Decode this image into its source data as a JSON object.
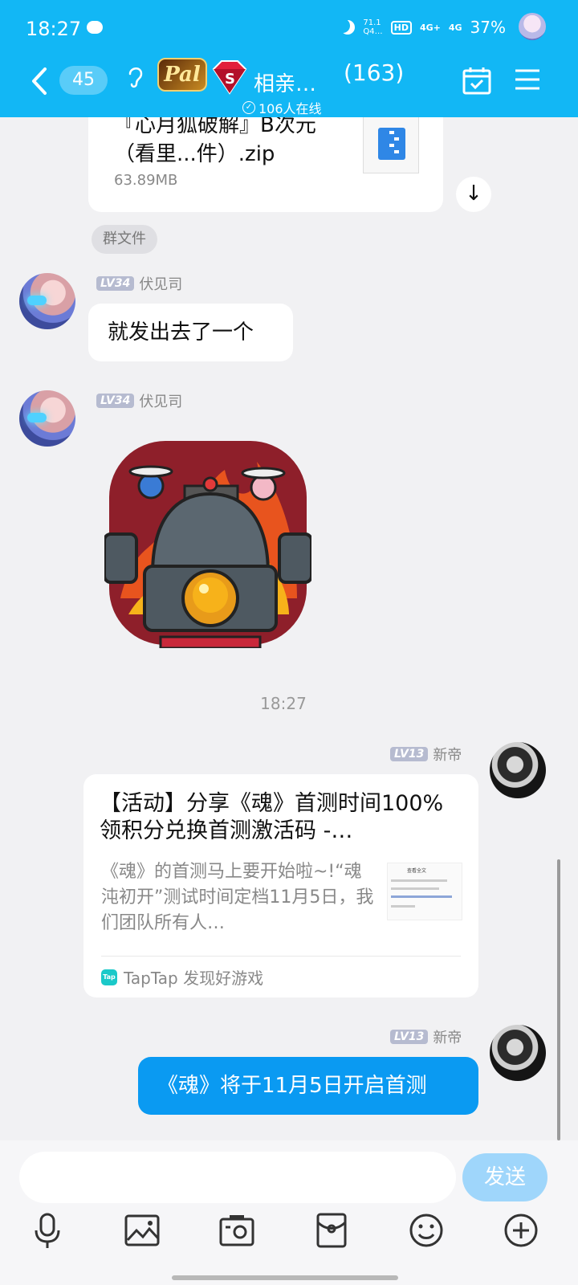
{
  "status_bar": {
    "time": "18:27",
    "net_speed_top": "71.1",
    "net_speed_bottom": "Q4…",
    "hd_badge": "HD",
    "signal_1": "4G+",
    "signal_2": "4G",
    "battery": "37%"
  },
  "header": {
    "unread_count": "45",
    "logo_text": "Pal",
    "group_name": "相亲…",
    "member_count": "(163)",
    "online_text": "106人在线"
  },
  "file_message": {
    "file_name": "『心月狐破解』B次元（看里...件）.zip",
    "file_size": "63.89MB",
    "tag": "群文件"
  },
  "messages": [
    {
      "level": "LV34",
      "sender": "伏见司",
      "text": "就发出去了一个"
    },
    {
      "level": "LV34",
      "sender": "伏见司",
      "sticker": "robot-sticker"
    }
  ],
  "timestamp": "18:27",
  "share_message": {
    "level": "LV13",
    "sender": "新帝",
    "title": "【活动】分享《魂》首测时间100%领积分兑换首测激活码 -…",
    "description": "《魂》的首测马上要开始啦~!“魂沌初开”测试时间定档11月5日，我们团队所有人…",
    "thumb_title": "查看全文",
    "source_icon": "Tap",
    "source": "TapTap 发现好游戏"
  },
  "last_message": {
    "level": "LV13",
    "sender": "新帝",
    "text": "《魂》将于11月5日开启首测"
  },
  "input": {
    "placeholder": "",
    "send_label": "发送"
  },
  "colors": {
    "header_bg": "#12b7f5",
    "outgoing_bubble": "#0a9af2",
    "send_button": "#9fd6fb"
  }
}
